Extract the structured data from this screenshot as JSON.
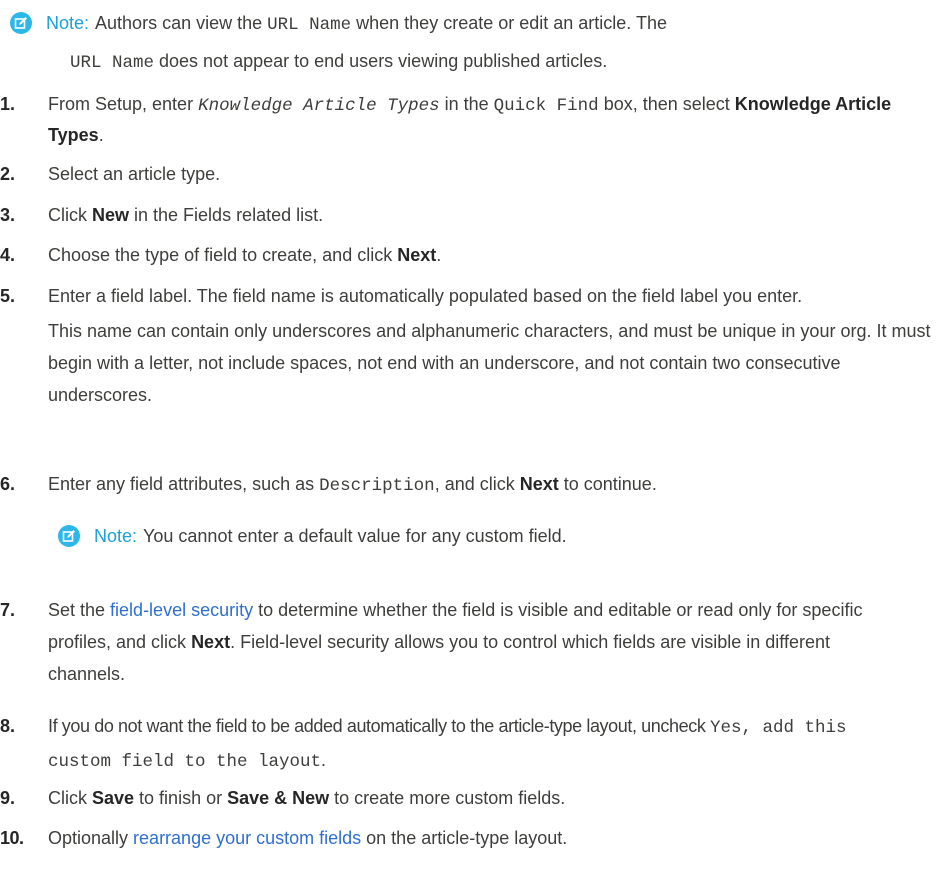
{
  "note_top": {
    "title": "Note:",
    "t1": " Authors can view the ",
    "code1": "URL Name",
    "t2": " when they create or edit an article. The ",
    "code2": "URL Name",
    "t3": " does not appear to end users viewing published articles."
  },
  "steps": [
    {
      "num": "1.",
      "a": "From Setup, enter ",
      "code_i": "Knowledge Article Types",
      "b": " in the ",
      "code": "Quick Find",
      "c": " box, then select ",
      "bold": "Knowledge Article Types",
      "d": "."
    },
    {
      "num": "2.",
      "text": "Select an article type."
    },
    {
      "num": "3.",
      "a": "Click ",
      "bold": "New",
      "b": " in the Fields related list."
    },
    {
      "num": "4.",
      "a": "Choose the type of field to create, and click ",
      "bold": "Next",
      "b": "."
    },
    {
      "num": "5.",
      "line1": "Enter a field label. The field name is automatically populated based on the field label you enter.",
      "para": "This name can contain only underscores and alphanumeric characters, and must be unique in your org. It must begin with a letter, not include spaces, not end with an underscore, and not contain two consecutive underscores."
    },
    {
      "num": "6.",
      "a": "Enter any field attributes, such as ",
      "code": "Description",
      "b": ", and click ",
      "bold": "Next",
      "c": " to continue."
    },
    {
      "num": "7.",
      "a": "Set the ",
      "link": "field-level security",
      "b": " to determine whether the field is visible and editable or read only for specific profiles, and click ",
      "bold": "Next",
      "c": ". Field-level security allows you to control which fields are visible in different channels."
    },
    {
      "num": "8.",
      "a": "If you do not want the field to be added automatically to the article-type layout, uncheck ",
      "code": "Yes, add this custom field to the layout",
      "b": "."
    },
    {
      "num": "9.",
      "a": "Click ",
      "bold1": "Save",
      "b": " to finish or ",
      "bold2": "Save & New",
      "c": " to create more custom fields."
    },
    {
      "num": "10.",
      "a": "Optionally ",
      "link": "rearrange your custom fields",
      "b": " on the article-type layout."
    }
  ],
  "note_inner": {
    "title": "Note:",
    "text": " You cannot enter a default value for any custom field."
  },
  "colors": {
    "note": "#1aa1d6",
    "icon": "#2bb7e8",
    "link": "#2f6fd1"
  },
  "icons": [
    "edit-note-icon"
  ]
}
